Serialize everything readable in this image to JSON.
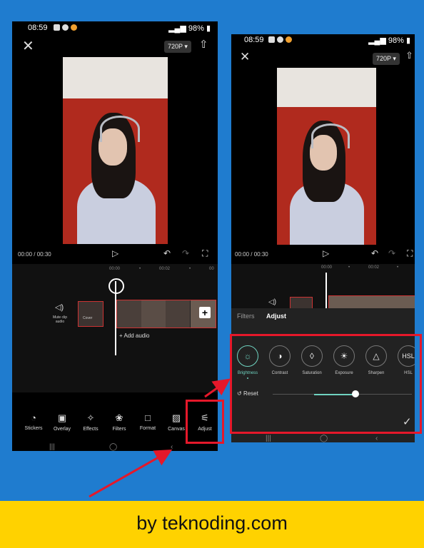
{
  "left": {
    "status": {
      "time": "08:59",
      "battery": "98%"
    },
    "resolution": "720P ▾",
    "time_current": "00:00",
    "time_total": "/ 00:30",
    "ruler": [
      "00:00",
      "•",
      "00:02",
      "•",
      "00"
    ],
    "mute_label": "Mute clip audio",
    "cover_label": "Cover",
    "add_audio": "+ Add audio",
    "tools": [
      "Stickers",
      "Overlay",
      "Effects",
      "Filters",
      "Format",
      "Canvas",
      "Adjust"
    ]
  },
  "right": {
    "status": {
      "time": "08:59",
      "battery": "98%"
    },
    "resolution": "720P ▾",
    "time_current": "00:00",
    "time_total": "/ 00:30",
    "ruler": [
      "00:00",
      "•",
      "00:02",
      "•"
    ],
    "tabs": {
      "filters": "Filters",
      "adjust": "Adjust"
    },
    "adjust_items": [
      "Brightness",
      "Contrast",
      "Saturation",
      "Exposure",
      "Sharpen",
      "HSL"
    ],
    "hsl_icon_text": "HSL",
    "reset": "Reset",
    "slider_value": 0.38
  },
  "banner": "by teknoding.com",
  "colors": {
    "highlight": "#e5182a",
    "accent": "#6fd3c0",
    "banner": "#ffd200",
    "background": "#1f7ccf"
  }
}
